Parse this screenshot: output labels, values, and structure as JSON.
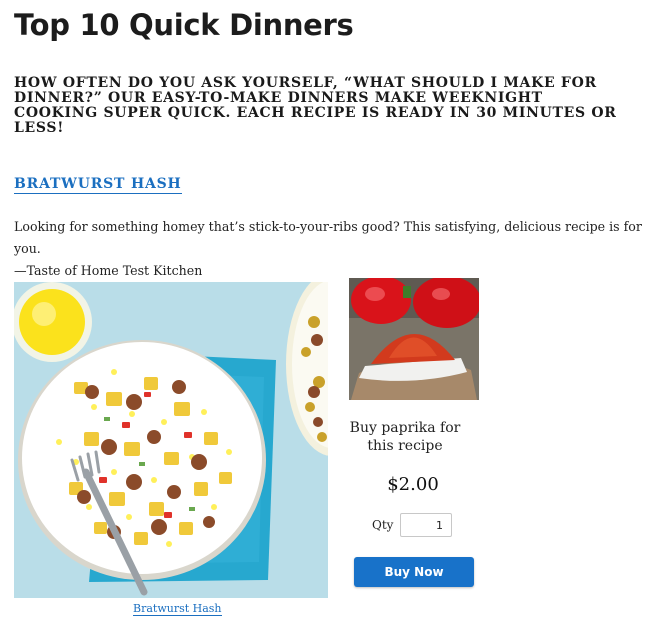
{
  "page": {
    "title": "Top 10 Quick Dinners",
    "intro": "How often do you ask yourself, “What should I make for dinner?” Our easy-to-make dinners make weeknight cooking super quick. Each recipe is ready in 30 minutes or less!"
  },
  "recipe": {
    "name": "Bratwurst Hash",
    "description": "Looking for something homey that’s stick-to-your-ribs good? This satisfying, delicious recipe is for you.",
    "attribution": "—Taste of Home Test Kitchen",
    "image_caption": "Bratwurst Hash"
  },
  "product": {
    "buy_text": "Buy paprika for this recipe",
    "price": "$2.00",
    "qty_label": "Qty",
    "qty_value": "1",
    "buy_button": "Buy Now"
  },
  "colors": {
    "link": "#1b6fc0",
    "button": "#1872c9"
  }
}
